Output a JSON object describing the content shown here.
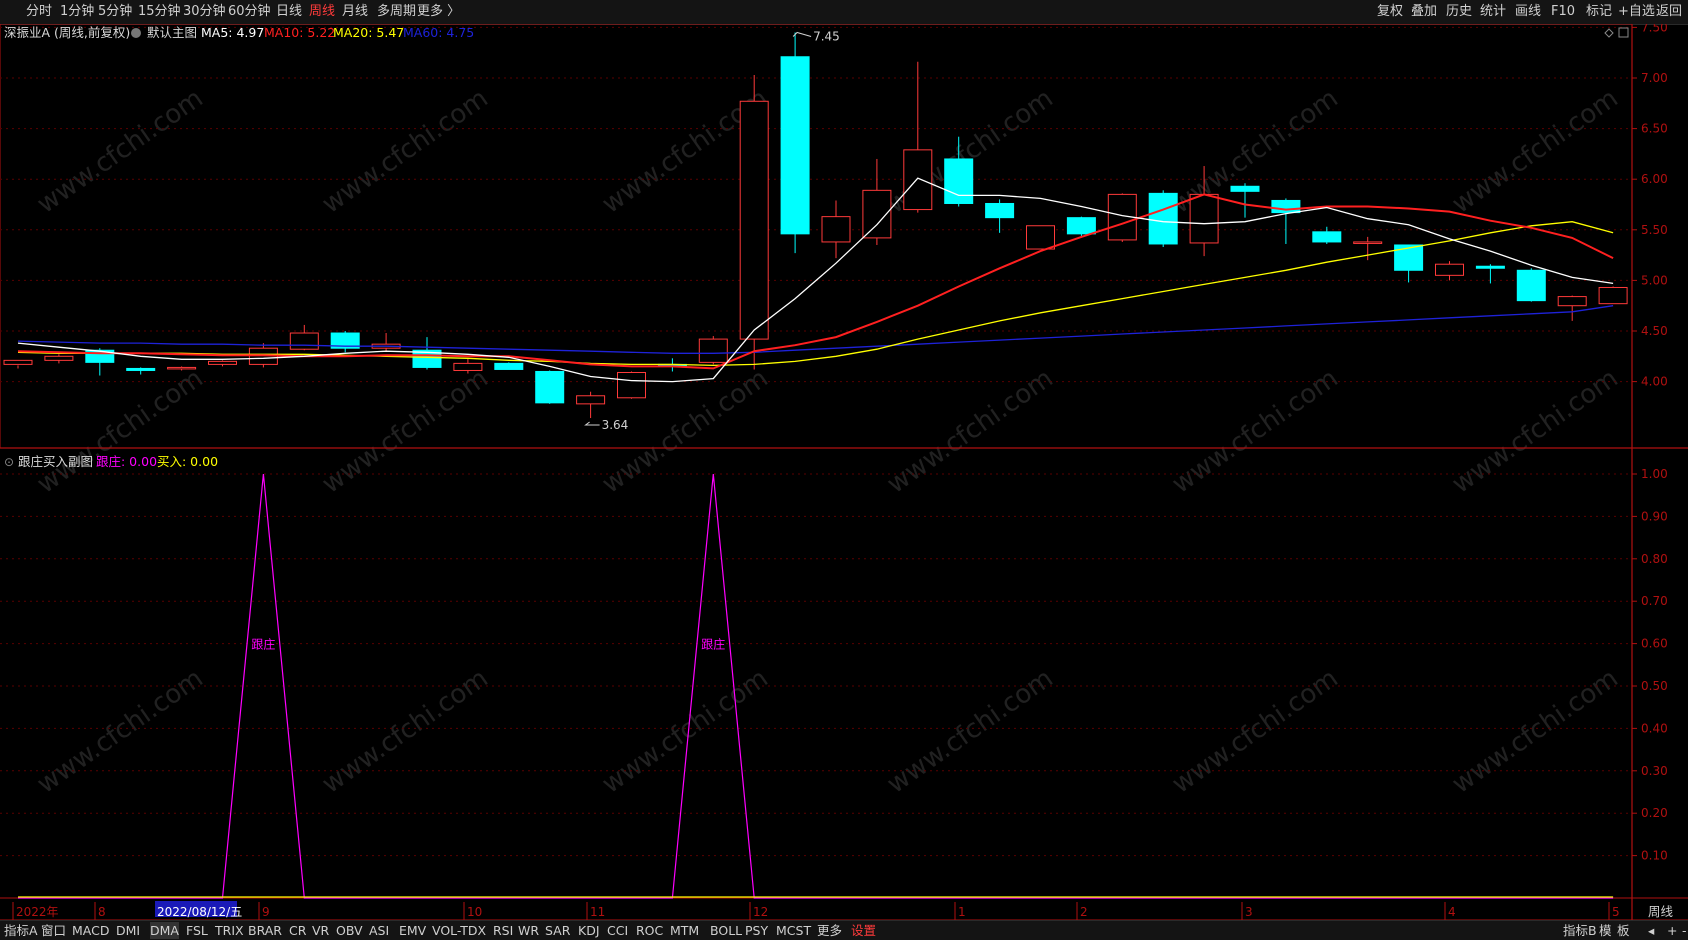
{
  "toolbar": {
    "periods": [
      "分时",
      "1分钟",
      "5分钟",
      "15分钟",
      "30分钟",
      "60分钟",
      "日线",
      "周线",
      "月线",
      "多周期",
      "更多 〉"
    ],
    "active_period": "周线",
    "right_items": [
      "复权",
      "叠加",
      "历史",
      "统计",
      "画线",
      "F10",
      "标记",
      "+自选",
      "返回"
    ]
  },
  "main_panel": {
    "stock_label": "深振业A (周线,前复权)",
    "chart_label": "默认主图",
    "ma": [
      {
        "label": "MA5: 4.97",
        "color": "#ffffff"
      },
      {
        "label": "MA10: 5.22",
        "color": "#ff2020"
      },
      {
        "label": "MA20: 5.47",
        "color": "#ffff00"
      },
      {
        "label": "MA60: 4.75",
        "color": "#1e22d8"
      }
    ],
    "max_label": "7.45",
    "min_label": "3.64"
  },
  "sub_panel": {
    "title": "跟庄买入副图",
    "genzhuang_label": "跟庄: 0.00",
    "mairu_label": "买入: 0.00",
    "peak_label": "跟庄"
  },
  "watermark": "www.cfchi.com",
  "x_axis": {
    "labels": [
      "2022年",
      "8",
      "2022/08/12/五",
      "9",
      "10",
      "11",
      "12",
      "1",
      "2",
      "3",
      "4",
      "5"
    ],
    "period_label": "周线"
  },
  "bottom_tabs": {
    "items": [
      "指标A",
      "窗口",
      "MACD",
      "DMI",
      "DMA",
      "FSL",
      "TRIX",
      "BRAR",
      "CR",
      "VR",
      "OBV",
      "ASI",
      "EMV",
      "VOL-TDX",
      "RSI",
      "WR",
      "SAR",
      "KDJ",
      "CCI",
      "ROC",
      "MTM",
      "BOLL",
      "PSY",
      "MCST",
      "更多",
      "设置"
    ],
    "selected": "DMA",
    "active": "设置",
    "right_items": [
      "指标B",
      "模",
      "板",
      "◂",
      "+",
      "-"
    ]
  },
  "colors": {
    "up": "#ff3a3a",
    "down": "#00ffff",
    "ma5": "#ffffff",
    "ma10": "#ff2020",
    "ma20": "#ffff00",
    "ma60": "#1e22d8",
    "genzhuang": "#ff00ff",
    "mairu": "#ffff00",
    "axis": "#b01010",
    "grid": "#5a0000"
  },
  "chart_data": [
    {
      "type": "candlestick",
      "period": "weekly",
      "ylim": [
        3.45,
        7.6
      ],
      "y_ticks": [
        4.0,
        4.5,
        5.0,
        5.5,
        6.0,
        6.5,
        7.0,
        7.5
      ],
      "candles": [
        [
          4.17,
          4.21,
          4.16,
          4.13
        ],
        [
          4.21,
          4.25,
          4.27,
          4.18
        ],
        [
          4.31,
          4.19,
          4.33,
          4.06
        ],
        [
          4.13,
          4.11,
          4.14,
          4.07
        ],
        [
          4.13,
          4.14,
          4.15,
          4.11
        ],
        [
          4.17,
          4.2,
          4.21,
          4.15
        ],
        [
          4.17,
          4.33,
          4.38,
          4.14
        ],
        [
          4.32,
          4.48,
          4.56,
          4.31
        ],
        [
          4.48,
          4.33,
          4.5,
          4.29
        ],
        [
          4.33,
          4.37,
          4.48,
          4.3
        ],
        [
          4.31,
          4.14,
          4.44,
          4.12
        ],
        [
          4.11,
          4.18,
          4.23,
          4.08
        ],
        [
          4.18,
          4.12,
          4.19,
          4.12
        ],
        [
          4.1,
          3.79,
          4.11,
          3.78
        ],
        [
          3.78,
          3.86,
          3.9,
          3.64
        ],
        [
          3.84,
          4.09,
          4.1,
          3.83
        ],
        [
          4.17,
          4.15,
          4.23,
          4.1
        ],
        [
          4.19,
          4.42,
          4.45,
          4.17
        ],
        [
          4.42,
          6.77,
          7.03,
          4.12
        ],
        [
          7.21,
          5.46,
          7.45,
          5.27
        ],
        [
          5.38,
          5.63,
          5.79,
          5.22
        ],
        [
          5.42,
          5.89,
          6.2,
          5.35
        ],
        [
          5.7,
          6.29,
          7.16,
          5.67
        ],
        [
          6.2,
          5.76,
          6.42,
          5.73
        ],
        [
          5.76,
          5.62,
          5.8,
          5.47
        ],
        [
          5.31,
          5.54,
          5.54,
          5.31
        ],
        [
          5.62,
          5.46,
          5.63,
          5.43
        ],
        [
          5.4,
          5.85,
          5.86,
          5.38
        ],
        [
          5.86,
          5.36,
          5.89,
          5.33
        ],
        [
          5.37,
          5.85,
          6.13,
          5.24
        ],
        [
          5.93,
          5.88,
          5.96,
          5.62
        ],
        [
          5.79,
          5.67,
          5.81,
          5.36
        ],
        [
          5.48,
          5.38,
          5.53,
          5.36
        ],
        [
          5.37,
          5.38,
          5.43,
          5.2
        ],
        [
          5.35,
          5.1,
          5.35,
          4.98
        ],
        [
          5.05,
          5.16,
          5.19,
          5.0
        ],
        [
          5.14,
          5.12,
          5.16,
          4.97
        ],
        [
          5.1,
          4.8,
          5.12,
          4.79
        ],
        [
          4.75,
          4.84,
          4.85,
          4.6
        ],
        [
          4.77,
          4.93,
          4.94,
          4.77
        ]
      ],
      "ma5": [
        4.38,
        4.34,
        4.3,
        4.25,
        4.22,
        4.22,
        4.23,
        4.25,
        4.28,
        4.3,
        4.29,
        4.27,
        4.24,
        4.15,
        4.05,
        4.01,
        4.0,
        4.03,
        4.51,
        4.82,
        5.17,
        5.55,
        6.01,
        5.84,
        5.84,
        5.81,
        5.73,
        5.64,
        5.58,
        5.56,
        5.58,
        5.66,
        5.72,
        5.61,
        5.55,
        5.41,
        5.29,
        5.15,
        5.03,
        4.97
      ],
      "ma10": [
        4.3,
        4.29,
        4.28,
        4.28,
        4.27,
        4.26,
        4.26,
        4.25,
        4.25,
        4.26,
        4.26,
        4.25,
        4.25,
        4.21,
        4.17,
        4.15,
        4.15,
        4.13,
        4.3,
        4.36,
        4.44,
        4.59,
        4.75,
        4.94,
        5.12,
        5.29,
        5.43,
        5.56,
        5.7,
        5.85,
        5.75,
        5.7,
        5.73,
        5.73,
        5.71,
        5.68,
        5.59,
        5.52,
        5.42,
        5.22
      ],
      "ma20": [
        4.29,
        4.28,
        4.28,
        4.28,
        4.28,
        4.27,
        4.27,
        4.27,
        4.26,
        4.25,
        4.24,
        4.23,
        4.21,
        4.2,
        4.18,
        4.17,
        4.17,
        4.16,
        4.17,
        4.2,
        4.25,
        4.32,
        4.42,
        4.51,
        4.6,
        4.68,
        4.75,
        4.82,
        4.89,
        4.96,
        5.03,
        5.1,
        5.18,
        5.25,
        5.32,
        5.39,
        5.47,
        5.54,
        5.58,
        5.47
      ],
      "ma60": [
        4.4,
        4.39,
        4.38,
        4.38,
        4.37,
        4.37,
        4.36,
        4.36,
        4.35,
        4.35,
        4.34,
        4.33,
        4.32,
        4.31,
        4.3,
        4.29,
        4.28,
        4.28,
        4.29,
        4.31,
        4.33,
        4.35,
        4.37,
        4.39,
        4.41,
        4.43,
        4.45,
        4.47,
        4.49,
        4.51,
        4.53,
        4.55,
        4.57,
        4.59,
        4.61,
        4.63,
        4.65,
        4.67,
        4.69,
        4.75
      ]
    },
    {
      "type": "line",
      "title": "跟庄买入副图",
      "ylim": [
        0,
        1.02
      ],
      "y_ticks": [
        0.1,
        0.2,
        0.3,
        0.4,
        0.5,
        0.6,
        0.7,
        0.8,
        0.9,
        1.0
      ],
      "series": [
        {
          "name": "跟庄",
          "values": [
            0,
            0,
            0,
            0,
            0,
            0,
            1,
            0,
            0,
            0,
            0,
            0,
            0,
            0,
            0,
            0,
            0,
            1,
            0,
            0,
            0,
            0,
            0,
            0,
            0,
            0,
            0,
            0,
            0,
            0,
            0,
            0,
            0,
            0,
            0,
            0,
            0,
            0,
            0,
            0
          ]
        },
        {
          "name": "买入",
          "values": [
            0,
            0,
            0,
            0,
            0,
            0,
            0,
            0,
            0,
            0,
            0,
            0,
            0,
            0,
            0,
            0,
            0,
            0,
            0,
            0,
            0,
            0,
            0,
            0,
            0,
            0,
            0,
            0,
            0,
            0,
            0,
            0,
            0,
            0,
            0,
            0,
            0,
            0,
            0,
            0
          ]
        }
      ]
    }
  ]
}
